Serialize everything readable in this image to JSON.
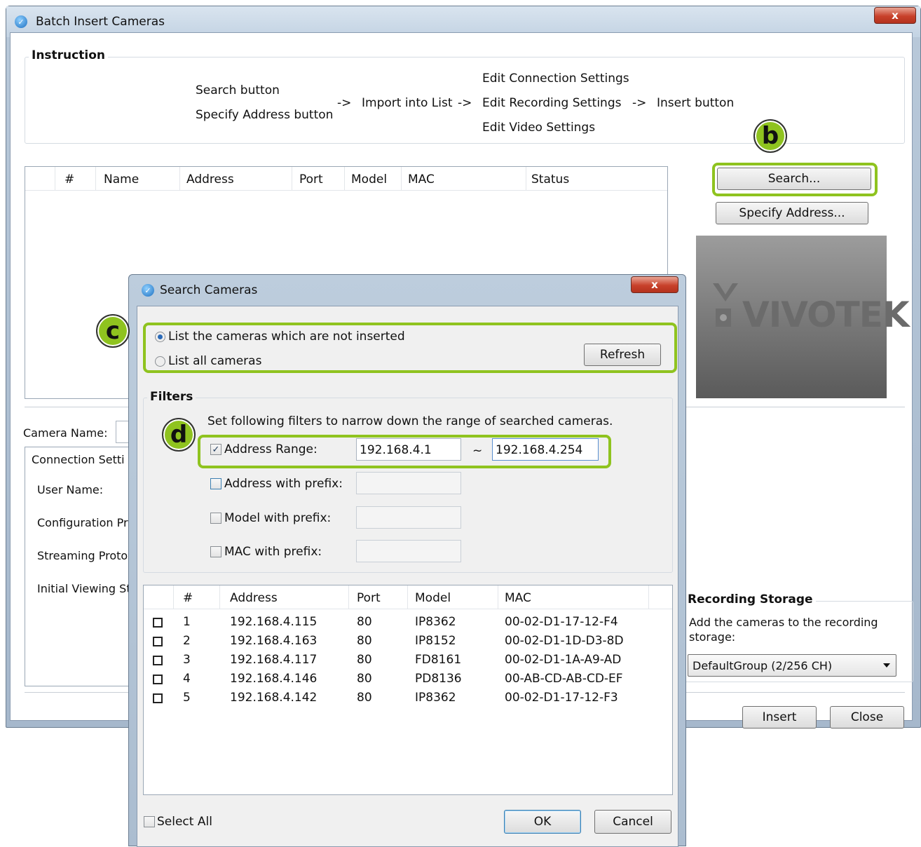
{
  "main_window": {
    "title": "Batch Insert Cameras",
    "close_label": "x",
    "instruction": {
      "title": "Instruction",
      "step1_a": "Search button",
      "step1_b": "Specify Address button",
      "arrow1": "->",
      "step2": "Import into List",
      "arrow2": "->",
      "step3_a": "Edit Connection Settings",
      "step3_b": "Edit Recording Settings",
      "step3_c": "Edit Video Settings",
      "arrow3": "->",
      "step4": "Insert button"
    },
    "camera_table": {
      "columns": [
        "#",
        "Name",
        "Address",
        "Port",
        "Model",
        "MAC",
        "Status"
      ]
    },
    "search_button": "Search...",
    "specify_address_button": "Specify Address...",
    "logo_text": "VIVOTEK",
    "camera_name_label": "Camera Name:",
    "connection_settings": {
      "title": "Connection Setti",
      "user_name": "User Name:",
      "configuration_protocol": "Configuration Pr",
      "streaming_protocol": "Streaming Proto",
      "initial_viewing": "Initial Viewing St"
    },
    "recording_storage": {
      "title": "Recording Storage",
      "description": "Add the cameras to the recording storage:",
      "selected": "DefaultGroup (2/256 CH)"
    },
    "insert_button": "Insert",
    "close_button": "Close"
  },
  "search_dialog": {
    "title": "Search Cameras",
    "close_label": "x",
    "radio_not_inserted": "List the cameras which are not inserted",
    "radio_all": "List all cameras",
    "refresh_button": "Refresh",
    "filters": {
      "title": "Filters",
      "description": "Set following filters to narrow down the range of searched cameras.",
      "address_range_label": "Address Range:",
      "address_range_from": "192.168.4.1",
      "tilde": "~",
      "address_range_to": "192.168.4.254",
      "address_prefix_label": "Address with prefix:",
      "model_prefix_label": "Model with prefix:",
      "mac_prefix_label": "MAC with prefix:"
    },
    "results": {
      "columns": [
        "#",
        "Address",
        "Port",
        "Model",
        "MAC"
      ],
      "rows": [
        {
          "num": "1",
          "address": "192.168.4.115",
          "port": "80",
          "model": "IP8362",
          "mac": "00-02-D1-17-12-F4"
        },
        {
          "num": "2",
          "address": "192.168.4.163",
          "port": "80",
          "model": "IP8152",
          "mac": "00-02-D1-1D-D3-8D"
        },
        {
          "num": "3",
          "address": "192.168.4.117",
          "port": "80",
          "model": "FD8161",
          "mac": "00-02-D1-1A-A9-AD"
        },
        {
          "num": "4",
          "address": "192.168.4.146",
          "port": "80",
          "model": "PD8136",
          "mac": "00-AB-CD-AB-CD-EF"
        },
        {
          "num": "5",
          "address": "192.168.4.142",
          "port": "80",
          "model": "IP8362",
          "mac": "00-02-D1-17-12-F3"
        }
      ]
    },
    "select_all_label": "Select All",
    "ok_button": "OK",
    "cancel_button": "Cancel"
  },
  "callouts": {
    "b": "b",
    "c": "c",
    "d": "d"
  },
  "colors": {
    "highlight": "#8fc31f",
    "title_bar": "#c3d3e3",
    "close_red": "#c8412b"
  }
}
